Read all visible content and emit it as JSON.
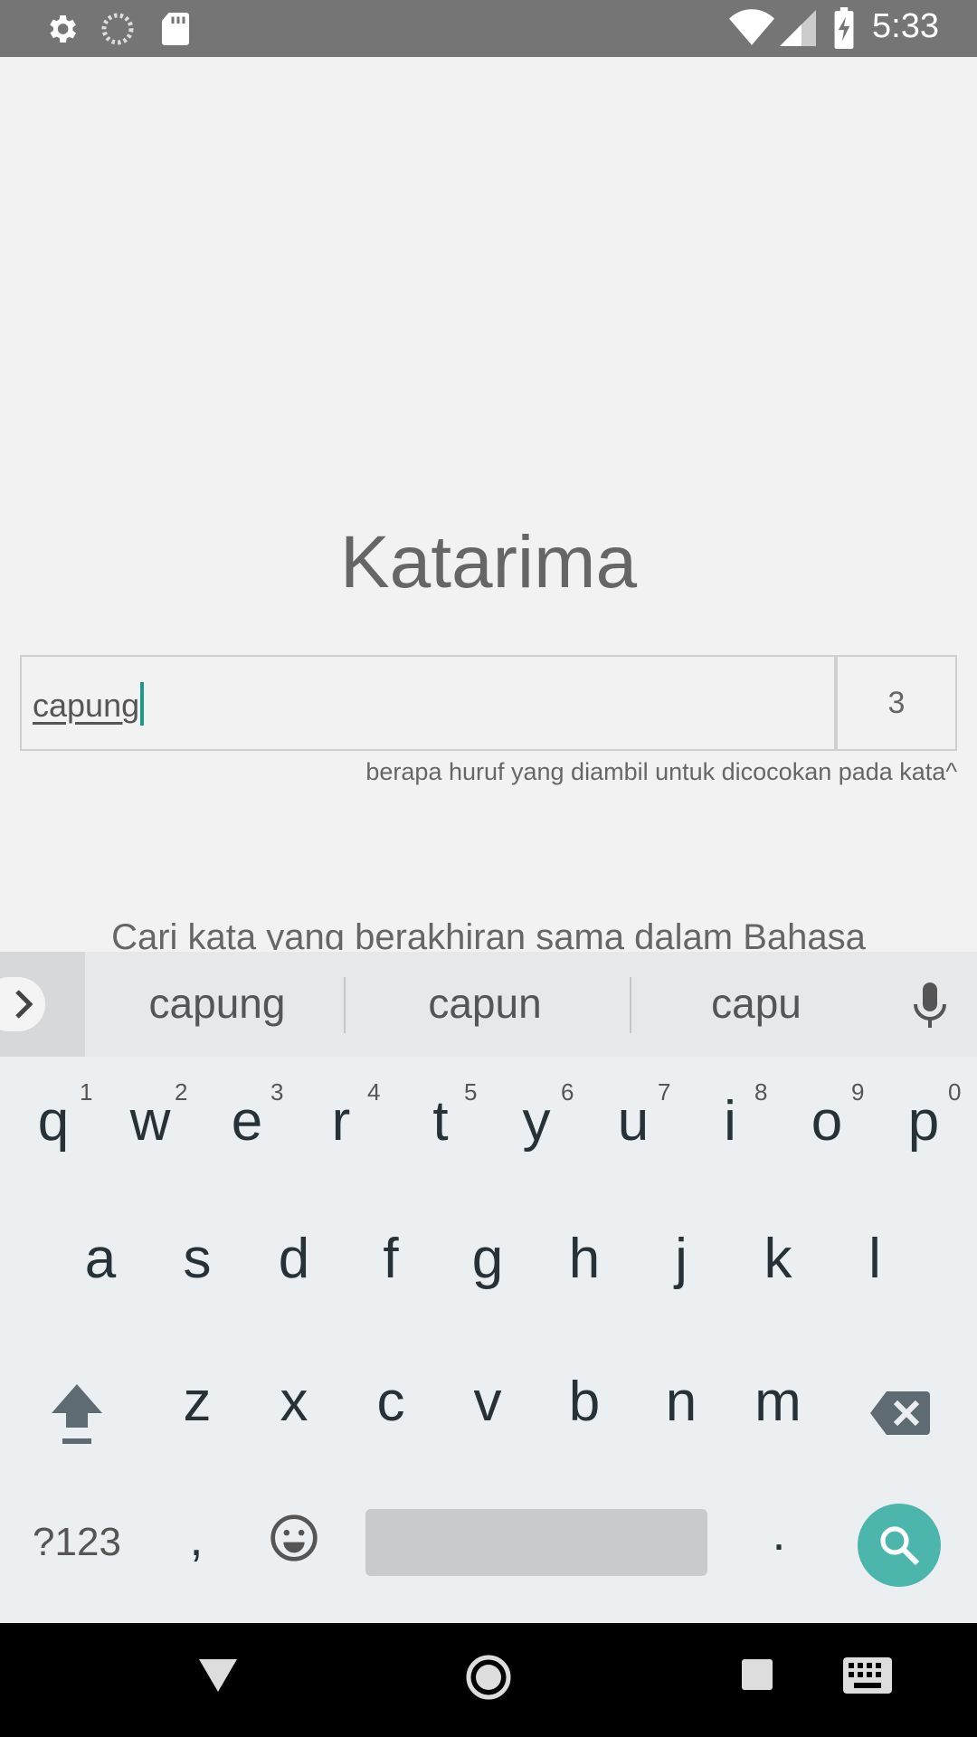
{
  "status_bar": {
    "time": "5:33",
    "icons": [
      "settings-icon",
      "sync-icon",
      "sd-card-icon",
      "wifi-icon",
      "signal-icon",
      "battery-charging-icon"
    ]
  },
  "app": {
    "title": "Katarima",
    "word_input_value": "capung",
    "count_value": "3",
    "hint": "berapa huruf yang diambil untuk dicocokan pada kata^",
    "description": "Cari kata yang berakhiran sama dalam Bahasa"
  },
  "keyboard": {
    "suggestions": [
      "capung",
      "capun",
      "capu"
    ],
    "row1": [
      {
        "key": "q",
        "num": "1"
      },
      {
        "key": "w",
        "num": "2"
      },
      {
        "key": "e",
        "num": "3"
      },
      {
        "key": "r",
        "num": "4"
      },
      {
        "key": "t",
        "num": "5"
      },
      {
        "key": "y",
        "num": "6"
      },
      {
        "key": "u",
        "num": "7"
      },
      {
        "key": "i",
        "num": "8"
      },
      {
        "key": "o",
        "num": "9"
      },
      {
        "key": "p",
        "num": "0"
      }
    ],
    "row2": [
      "a",
      "s",
      "d",
      "f",
      "g",
      "h",
      "j",
      "k",
      "l"
    ],
    "row3": [
      "z",
      "x",
      "c",
      "v",
      "b",
      "n",
      "m"
    ],
    "symbols_label": "?123",
    "comma": ",",
    "period": ".",
    "accent_color": "#4db6ac"
  },
  "nav_bar": {
    "icons": [
      "back-icon",
      "home-icon",
      "recents-icon",
      "keyboard-switch-icon"
    ]
  }
}
